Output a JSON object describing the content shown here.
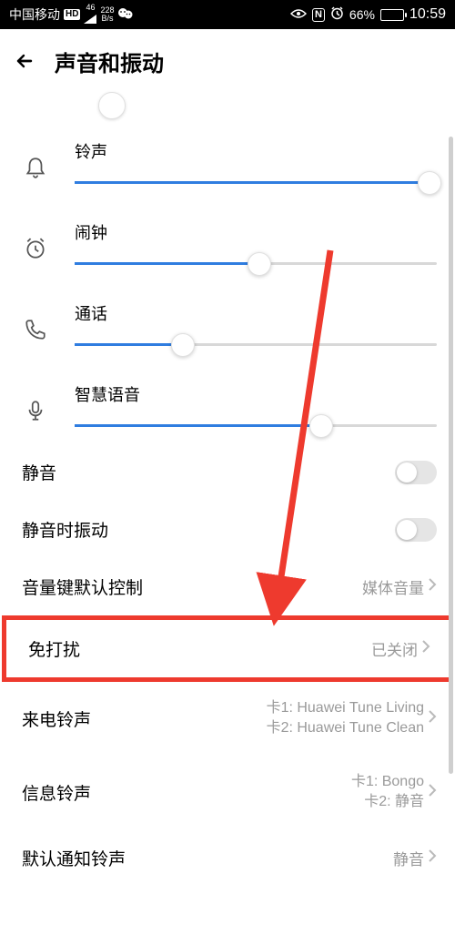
{
  "status_bar": {
    "carrier": "中国移动",
    "hd_badge": "HD",
    "net_top": "46",
    "speed_top": "228",
    "speed_bottom": "B/s",
    "battery_pct": "66%",
    "time": "10:59"
  },
  "header": {
    "title": "声音和振动"
  },
  "sliders": {
    "ringtone": {
      "label": "铃声",
      "value_pct": 98
    },
    "alarm": {
      "label": "闹钟",
      "value_pct": 51
    },
    "call": {
      "label": "通话",
      "value_pct": 30
    },
    "voice": {
      "label": "智慧语音",
      "value_pct": 68
    }
  },
  "rows": {
    "mute": {
      "title": "静音"
    },
    "vibrate_mute": {
      "title": "静音时振动"
    },
    "vol_key": {
      "title": "音量键默认控制",
      "value": "媒体音量"
    },
    "dnd": {
      "title": "免打扰",
      "value": "已关闭"
    },
    "ring_tone": {
      "title": "来电铃声",
      "line1": "卡1: Huawei Tune Living",
      "line2": "卡2: Huawei Tune Clean"
    },
    "msg_tone": {
      "title": "信息铃声",
      "line1": "卡1: Bongo",
      "line2": "卡2: 静音"
    },
    "default_notify": {
      "title": "默认通知铃声",
      "value": "静音"
    }
  }
}
